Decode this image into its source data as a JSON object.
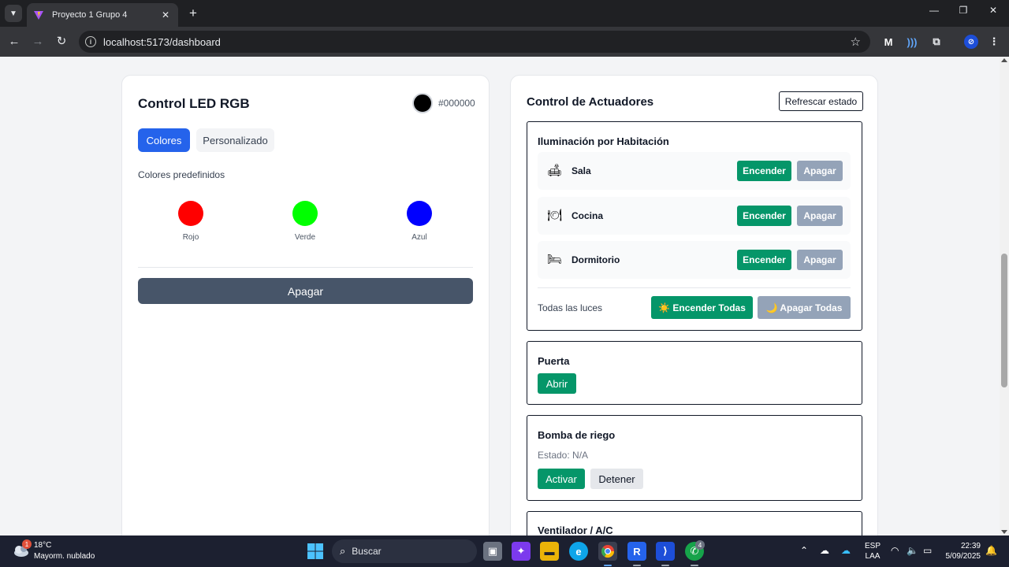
{
  "browser": {
    "tab_title": "Proyecto 1 Grupo 4",
    "url": "localhost:5173/dashboard"
  },
  "led": {
    "title": "Control LED RGB",
    "current_color": "#000000",
    "current_hex_label": "#000000",
    "tabs": [
      {
        "label": "Colores",
        "active": true
      },
      {
        "label": "Personalizado",
        "active": false
      }
    ],
    "preset_label": "Colores predefinidos",
    "presets": [
      {
        "name": "Rojo",
        "color": "#ff0000"
      },
      {
        "name": "Verde",
        "color": "#00ff00"
      },
      {
        "name": "Azul",
        "color": "#0000ff"
      }
    ],
    "off_button": "Apagar"
  },
  "actuators": {
    "title": "Control de Actuadores",
    "refresh_button": "Refrescar estado",
    "lighting": {
      "title": "Iluminación por Habitación",
      "rooms": [
        {
          "name": "Sala",
          "icon": "sofa-icon",
          "on_label": "Encender",
          "off_label": "Apagar"
        },
        {
          "name": "Cocina",
          "icon": "plate-icon",
          "on_label": "Encender",
          "off_label": "Apagar"
        },
        {
          "name": "Dormitorio",
          "icon": "bed-icon",
          "on_label": "Encender",
          "off_label": "Apagar"
        }
      ],
      "all_label": "Todas las luces",
      "all_on": "☀️ Encender Todas",
      "all_off": "🌙 Apagar Todas"
    },
    "door": {
      "title": "Puerta",
      "open_button": "Abrir"
    },
    "pump": {
      "title": "Bomba de riego",
      "status": "Estado: N/A",
      "start_button": "Activar",
      "stop_button": "Detener"
    },
    "fan": {
      "title": "Ventilador / A/C"
    }
  },
  "taskbar": {
    "weather_temp": "18°C",
    "weather_desc": "Mayorm. nublado",
    "weather_badge": "1",
    "search_label": "Buscar",
    "whatsapp_badge": "4",
    "lang_1": "ESP",
    "lang_2": "LAA",
    "time": "22:39",
    "date": "5/09/2025"
  }
}
